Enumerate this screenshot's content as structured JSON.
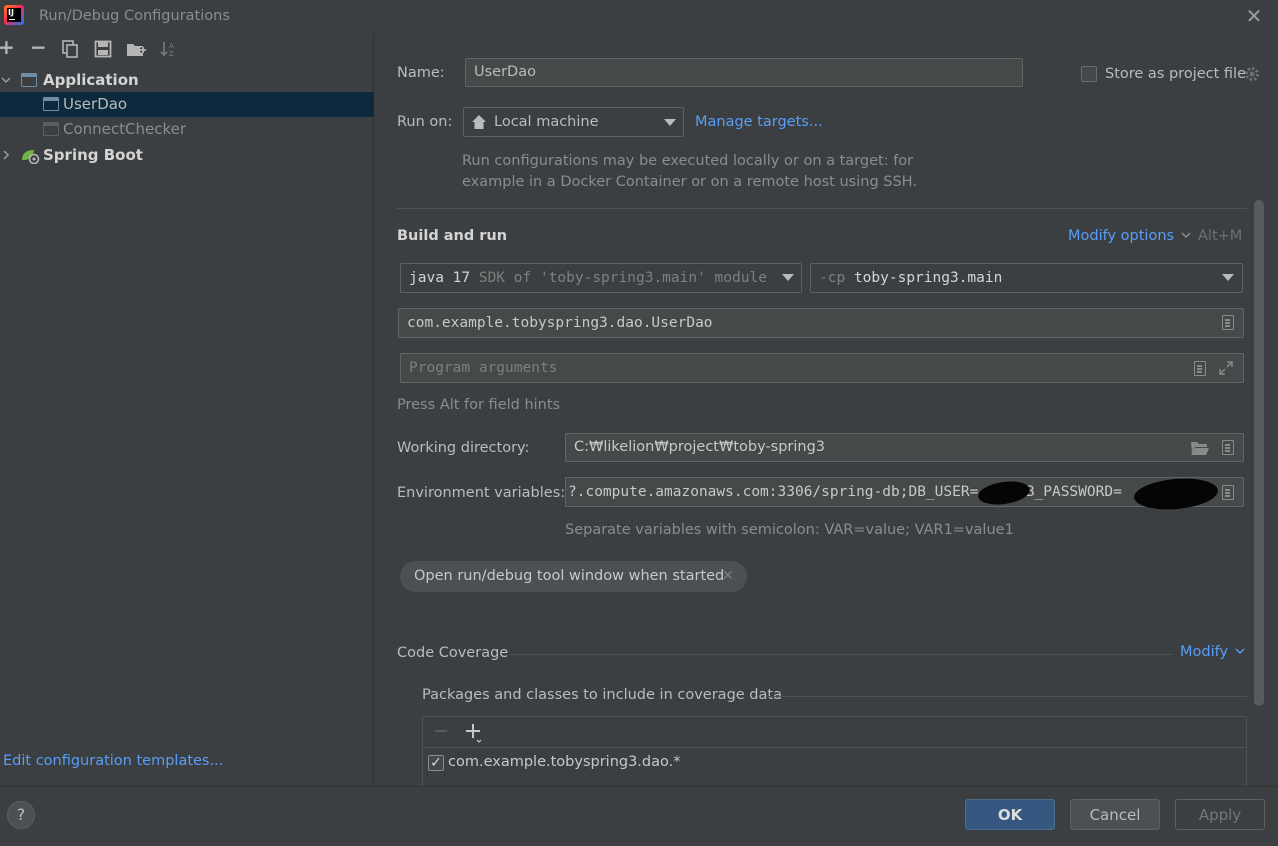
{
  "window": {
    "title": "Run/Debug Configurations"
  },
  "left": {
    "toolbar": {
      "add_glyph": "+",
      "remove_glyph": "−"
    },
    "tree": [
      {
        "label": "Application",
        "expanded": true,
        "children": [
          {
            "label": "UserDao",
            "selected": true
          },
          {
            "label": "ConnectChecker"
          }
        ]
      },
      {
        "label": "Spring Boot",
        "expanded": false
      }
    ],
    "edit_templates_link": "Edit configuration templates..."
  },
  "form": {
    "name_label": "Name:",
    "name_value": "UserDao",
    "store_as_project_file_label": "Store as project file",
    "run_on_label": "Run on:",
    "run_on_value": "Local machine",
    "manage_targets_link": "Manage targets...",
    "run_on_hint_line1": "Run configurations may be executed locally or on a target: for",
    "run_on_hint_line2": "example in a Docker Container or on a remote host using SSH.",
    "build_and_run_title": "Build and run",
    "modify_options_link": "Modify options",
    "modify_options_shortcut": "Alt+M",
    "jdk_value_main": "java 17",
    "jdk_value_sub": "SDK of 'toby-spring3.main' module",
    "classpath_prefix": "-cp",
    "classpath_value": "toby-spring3.main",
    "main_class_value": "com.example.tobyspring3.dao.UserDao",
    "program_args_placeholder": "Program arguments",
    "field_hints_hint": "Press Alt for field hints",
    "working_dir_label": "Working directory:",
    "working_dir_value": "C:₩likelion₩project₩toby-spring3",
    "env_vars_label": "Environment variables:",
    "env_vars_value_part1": "?.compute.amazonaws.com:3306/spring-db;DB_USER=",
    "env_vars_value_part2": ";DB_PASSWORD=",
    "env_vars_hint": "Separate variables with semicolon: VAR=value; VAR1=value1",
    "tag_chip_label": "Open run/debug tool window when started"
  },
  "coverage": {
    "title": "Code Coverage",
    "modify_link": "Modify",
    "packages_title": "Packages and classes to include in coverage data",
    "entries": [
      {
        "pattern": "com.example.tobyspring3.dao.*",
        "checked": true
      }
    ]
  },
  "buttons": {
    "help": "?",
    "ok": "OK",
    "cancel": "Cancel",
    "apply": "Apply"
  },
  "colors": {
    "background": "#3c3f41",
    "selection": "#0d293e",
    "link": "#589df6",
    "ok_button": "#365880"
  }
}
